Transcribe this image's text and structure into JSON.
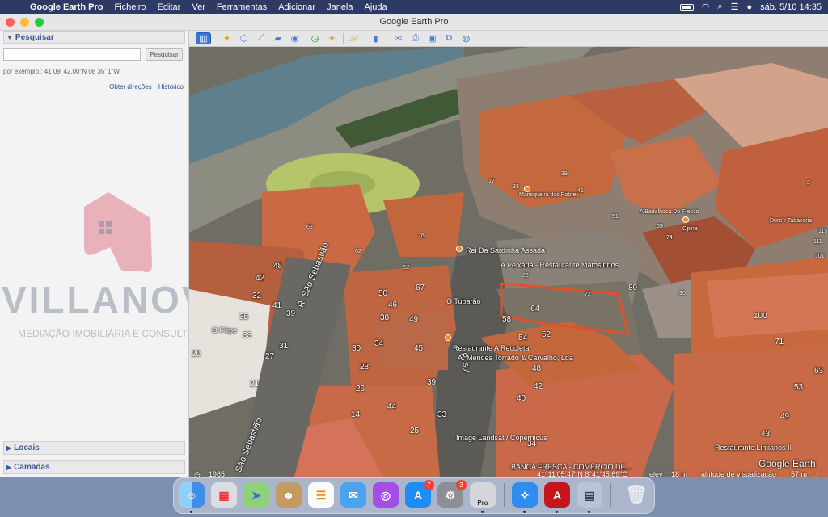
{
  "menubar": {
    "app_name": "Google Earth Pro",
    "items": [
      "Ficheiro",
      "Editar",
      "Ver",
      "Ferramentas",
      "Adicionar",
      "Janela",
      "Ajuda"
    ],
    "datetime": "sáb. 5/10  14:35"
  },
  "window": {
    "title": "Google Earth Pro"
  },
  "sidebar": {
    "search_header": "Pesquisar",
    "search_placeholder": "",
    "search_button": "Pesquisar",
    "example": "por exemplo,: 41 09' 42.00\"N 08 35' 1\"W",
    "link_directions": "Obter direções",
    "link_history": "Histórico",
    "places_header": "Locais",
    "layers_header": "Camadas"
  },
  "watermark": {
    "brand": "VILLANOVA",
    "tagline": "MEDIAÇÃO IMOBILIÁRIA E CONSULTORIA"
  },
  "toolbar": {
    "icons": [
      "sidebar-toggle-icon",
      "placemark-icon",
      "polygon-icon",
      "path-icon",
      "image-overlay-icon",
      "record-tour-icon",
      "historical-imagery-icon",
      "sun-icon",
      "planets-icon",
      "ruler-icon",
      "email-icon",
      "print-icon",
      "save-image-icon",
      "view-in-maps-icon"
    ]
  },
  "map": {
    "labels": {
      "rei_sardinha": "Rei Da Sardinha Assada",
      "peixaria": "A Peixaria - Restaurante Matosinhos",
      "tubarao": "O Tubarão",
      "recoleta": "Restaurante A Recoleta",
      "mendes": "A. Mendes Torrado & Carvalho, Lda",
      "filipe": "O Filipe",
      "sao_sebastiao": "R. São Sebastião",
      "sao_sebastiao_2": "São Sebastião",
      "r_sul": "R. Sul",
      "marisqueira": "Marisqueira dos Pobres",
      "badalhoca": "A Badalhoca Do Fresco",
      "opina": "Opina",
      "duros": "Duro's Tabacaria",
      "limianos": "Restaurante Limianos II",
      "banca": "BANCA FRESCA - COMÉRCIO DE...",
      "landsat": "Image Landsat / Copernicus",
      "google_earth": "Google Earth"
    },
    "numbers": [
      "68",
      "76",
      "62",
      "48",
      "42",
      "32",
      "35",
      "33",
      "20",
      "41",
      "39",
      "31",
      "27",
      "21",
      "50",
      "46",
      "52",
      "67",
      "38",
      "49",
      "30",
      "34",
      "45",
      "28",
      "26",
      "44",
      "14",
      "39",
      "33",
      "25",
      "26",
      "64",
      "72",
      "80",
      "58",
      "54",
      "52",
      "48",
      "42",
      "40",
      "34",
      "90",
      "100",
      "71",
      "63",
      "53",
      "49",
      "43",
      "115",
      "111",
      "101",
      "2",
      "17",
      "33",
      "39",
      "41",
      "51",
      "69",
      "74"
    ]
  },
  "statusbar": {
    "year": "1985",
    "coords": "41°11'05.47\"N   8°41'45.69\"O",
    "elev_label": "elev",
    "elev_value": "18 m",
    "alt_label": "altitude de visualização",
    "alt_value": "57 m"
  },
  "dock": {
    "apps": [
      "Finder",
      "Launchpad",
      "Maps",
      "Contacts",
      "Reminders",
      "Mail",
      "Podcasts",
      "App Store",
      "System Settings",
      "Google Earth Pro",
      "Safari",
      "Acrobat",
      "Preview",
      "Trash"
    ],
    "badges": {
      "app_store": "7",
      "settings": "3"
    },
    "earth_label": "Pro"
  },
  "colors": {
    "accent": "#3b73d6",
    "selection_outline": "#e0502a",
    "poi": "#f08a24",
    "roof": "#c96a45"
  }
}
